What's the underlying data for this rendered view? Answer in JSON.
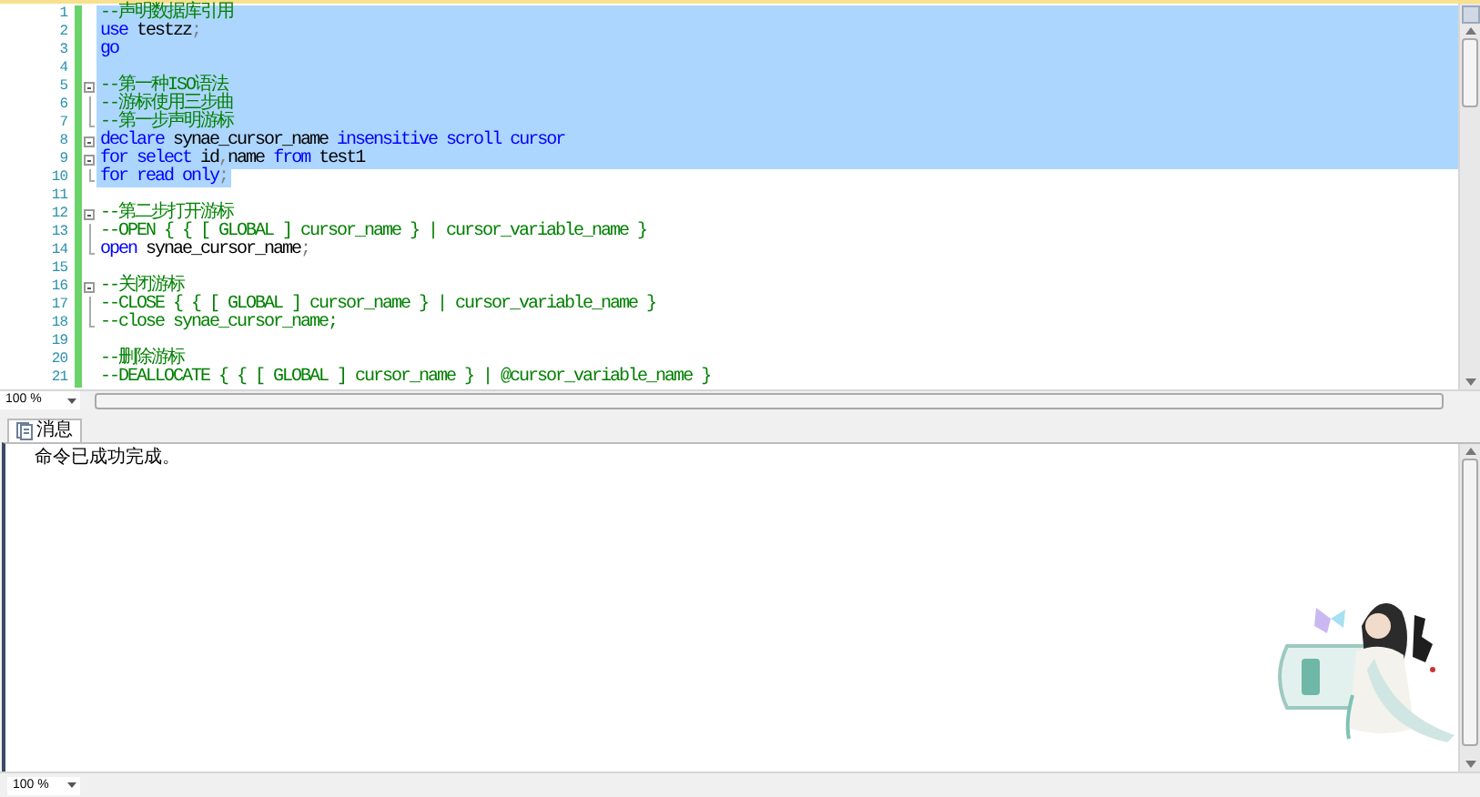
{
  "editor": {
    "lines": [
      {
        "number": "1",
        "kind": "plain",
        "selected": true,
        "tokens": [
          {
            "text": "--声明数据库引用",
            "kind": "comment"
          }
        ]
      },
      {
        "number": "2",
        "kind": "plain",
        "selected": true,
        "tokens": [
          {
            "text": "use",
            "kind": "keyword"
          },
          {
            "text": " testzz",
            "kind": "plain"
          },
          {
            "text": ";",
            "kind": "punct"
          }
        ]
      },
      {
        "number": "3",
        "kind": "plain",
        "selected": true,
        "tokens": [
          {
            "text": "go",
            "kind": "keyword"
          }
        ]
      },
      {
        "number": "4",
        "kind": "plain",
        "selected": true
      },
      {
        "number": "5",
        "kind": "fold_start",
        "selected": true,
        "tokens": [
          {
            "text": "--第一种ISO语法",
            "kind": "comment"
          }
        ]
      },
      {
        "number": "6",
        "kind": "fold_inner",
        "selected": true,
        "tokens": [
          {
            "text": "--游标使用三步曲",
            "kind": "comment"
          }
        ]
      },
      {
        "number": "7",
        "kind": "fold_end",
        "selected": true,
        "tokens": [
          {
            "text": "--第一步声明游标",
            "kind": "comment"
          }
        ]
      },
      {
        "number": "8",
        "kind": "fold_start",
        "selected": true,
        "tokens": [
          {
            "text": "declare",
            "kind": "keyword"
          },
          {
            "text": " synae_cursor_name ",
            "kind": "plain"
          },
          {
            "text": "insensitive scroll cursor",
            "kind": "keyword"
          }
        ]
      },
      {
        "number": "9",
        "kind": "fold_start",
        "selected": true,
        "tokens": [
          {
            "text": "for select",
            "kind": "keyword"
          },
          {
            "text": " id",
            "kind": "plain"
          },
          {
            "text": ",",
            "kind": "punct"
          },
          {
            "text": "name ",
            "kind": "plain"
          },
          {
            "text": "from",
            "kind": "keyword"
          },
          {
            "text": " test1",
            "kind": "plain"
          }
        ]
      },
      {
        "number": "10",
        "kind": "fold_end",
        "selected": true,
        "tokens": [
          {
            "text": "for read only",
            "kind": "keyword"
          },
          {
            "text": ";",
            "kind": "punct"
          }
        ]
      },
      {
        "number": "11",
        "kind": "plain",
        "selected": false
      },
      {
        "number": "12",
        "kind": "fold_start",
        "selected": false,
        "tokens": [
          {
            "text": "--第二步打开游标",
            "kind": "comment"
          }
        ]
      },
      {
        "number": "13",
        "kind": "fold_inner",
        "selected": false,
        "tokens": [
          {
            "text": "--OPEN { { [ GLOBAL ] cursor_name } | cursor_variable_name }",
            "kind": "comment"
          }
        ]
      },
      {
        "number": "14",
        "kind": "fold_end",
        "selected": false,
        "tokens": [
          {
            "text": "open",
            "kind": "keyword"
          },
          {
            "text": " synae_cursor_name",
            "kind": "plain"
          },
          {
            "text": ";",
            "kind": "punct"
          }
        ]
      },
      {
        "number": "15",
        "kind": "plain",
        "selected": false
      },
      {
        "number": "16",
        "kind": "fold_start",
        "selected": false,
        "tokens": [
          {
            "text": "--关闭游标",
            "kind": "comment"
          }
        ]
      },
      {
        "number": "17",
        "kind": "fold_inner",
        "selected": false,
        "tokens": [
          {
            "text": "--CLOSE { { [ GLOBAL ] cursor_name } | cursor_variable_name }",
            "kind": "comment"
          }
        ]
      },
      {
        "number": "18",
        "kind": "fold_end",
        "selected": false,
        "tokens": [
          {
            "text": "--close synae_cursor_name;",
            "kind": "comment"
          }
        ]
      },
      {
        "number": "19",
        "kind": "plain",
        "selected": false
      },
      {
        "number": "20",
        "kind": "plain",
        "selected": false,
        "tokens": [
          {
            "text": "--删除游标",
            "kind": "comment"
          }
        ]
      },
      {
        "number": "21",
        "kind": "plain",
        "selected": false,
        "tokens": [
          {
            "text": "--DEALLOCATE { { [ GLOBAL ] cursor_name } | @cursor_variable_name }",
            "kind": "comment"
          }
        ]
      }
    ],
    "zoom": "100 %"
  },
  "results": {
    "tabs": [
      {
        "label": "消息",
        "selected": true
      }
    ],
    "messages": [
      "命令已成功完成。"
    ],
    "zoom": "100 %"
  }
}
